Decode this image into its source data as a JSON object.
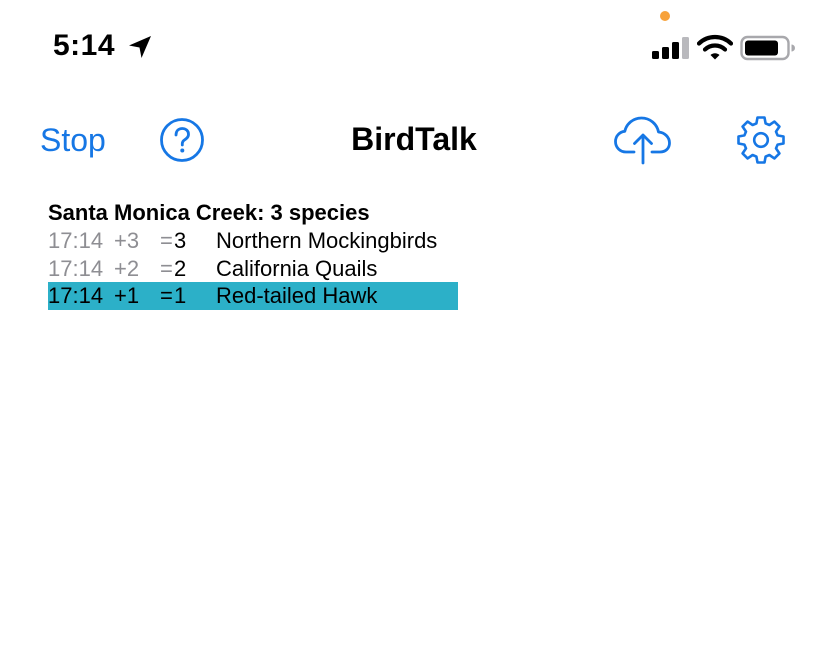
{
  "colors": {
    "accent": "#1677e5",
    "selection": "#2cb0c8",
    "privacy_dot": "#f7a23b",
    "muted_text": "#8e8e93"
  },
  "status_bar": {
    "time": "5:14",
    "icons": [
      "location-arrow-icon",
      "cellular-signal-icon",
      "wifi-icon",
      "battery-icon"
    ]
  },
  "nav": {
    "title": "BirdTalk",
    "stop_label": "Stop",
    "help_icon": "question-circle-icon",
    "upload_icon": "cloud-upload-icon",
    "settings_icon": "gear-icon"
  },
  "list": {
    "heading": "Santa Monica Creek: 3 species",
    "rows": [
      {
        "time": "17:14",
        "delta": "+3",
        "eq": "=",
        "total": "3",
        "species": "Northern Mockingbirds",
        "selected": false
      },
      {
        "time": "17:14",
        "delta": "+2",
        "eq": "=",
        "total": "2",
        "species": "California Quails",
        "selected": false
      },
      {
        "time": "17:14",
        "delta": "+1",
        "eq": "=",
        "total": "1",
        "species": "Red-tailed Hawk",
        "selected": true
      }
    ]
  }
}
